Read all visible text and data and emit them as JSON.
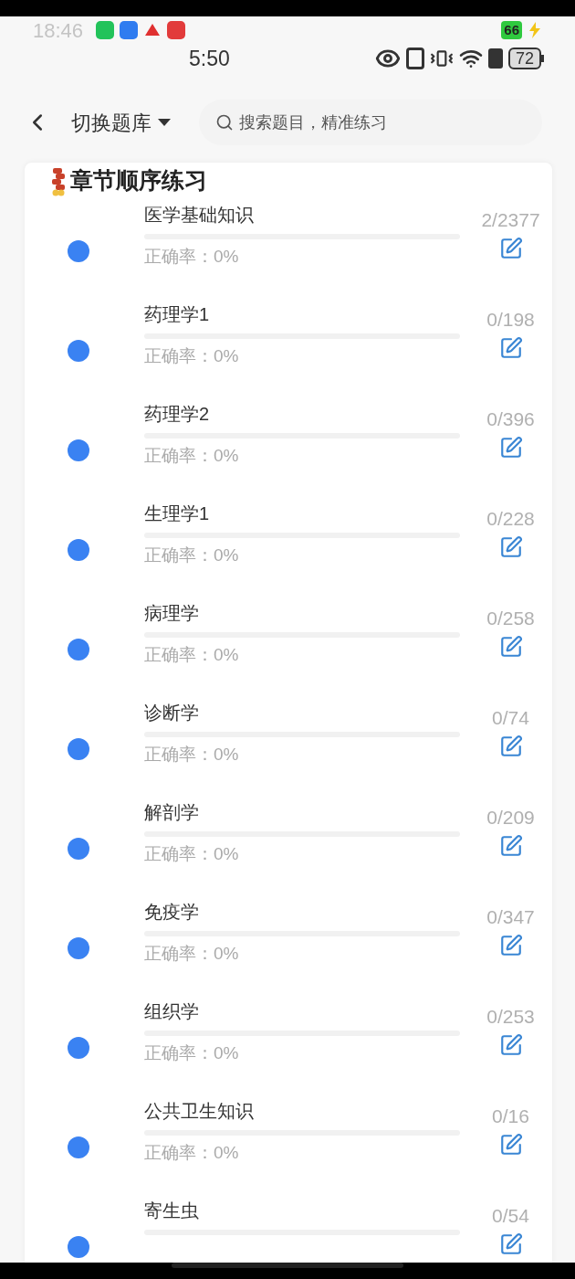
{
  "status_bar": {
    "faded_time": "18:46",
    "badge": "66",
    "time": "5:50",
    "battery": "72"
  },
  "header": {
    "switch_label": "切换题库",
    "search_placeholder": "搜索题目，精准练习"
  },
  "section": {
    "title": "章节顺序练习"
  },
  "chapters": [
    {
      "name": "医学基础知识",
      "count": "2/2377",
      "accuracy": "正确率：0%"
    },
    {
      "name": "药理学1",
      "count": "0/198",
      "accuracy": "正确率：0%"
    },
    {
      "name": "药理学2",
      "count": "0/396",
      "accuracy": "正确率：0%"
    },
    {
      "name": "生理学1",
      "count": "0/228",
      "accuracy": "正确率：0%"
    },
    {
      "name": "病理学",
      "count": "0/258",
      "accuracy": "正确率：0%"
    },
    {
      "name": "诊断学",
      "count": "0/74",
      "accuracy": "正确率：0%"
    },
    {
      "name": "解剖学",
      "count": "0/209",
      "accuracy": "正确率：0%"
    },
    {
      "name": "免疫学",
      "count": "0/347",
      "accuracy": "正确率：0%"
    },
    {
      "name": "组织学",
      "count": "0/253",
      "accuracy": "正确率：0%"
    },
    {
      "name": "公共卫生知识",
      "count": "0/16",
      "accuracy": "正确率：0%"
    },
    {
      "name": "寄生虫",
      "count": "0/54"
    }
  ]
}
